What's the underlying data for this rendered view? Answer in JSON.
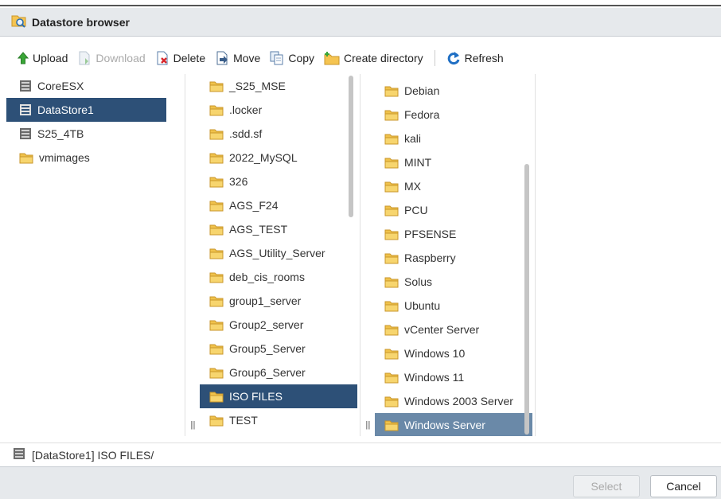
{
  "window": {
    "title": "Datastore browser"
  },
  "toolbar": {
    "upload": "Upload",
    "download": "Download",
    "delete": "Delete",
    "move": "Move",
    "copy": "Copy",
    "create_directory": "Create directory",
    "refresh": "Refresh"
  },
  "columns": {
    "datastores": [
      "CoreESX",
      "DataStore1",
      "S25_4TB",
      "vmimages"
    ],
    "datastore_selected": "DataStore1",
    "folders": [
      "_S25_MSE",
      ".locker",
      ".sdd.sf",
      "2022_MySQL",
      "326",
      "AGS_F24",
      "AGS_TEST",
      "AGS_Utility_Server",
      "deb_cis_rooms",
      "group1_server",
      "Group2_server",
      "Group5_Server",
      "Group6_Server",
      "ISO FILES",
      "TEST"
    ],
    "folder_selected": "ISO FILES",
    "iso_folders": [
      "Debian",
      "Fedora",
      "kali",
      "MINT",
      "MX",
      "PCU",
      "PFSENSE",
      "Raspberry",
      "Solus",
      "Ubuntu",
      "vCenter Server",
      "Windows 10",
      "Windows 11",
      "Windows 2003 Server",
      "Windows Server"
    ],
    "iso_selected": "Windows Server"
  },
  "status": {
    "path": "[DataStore1] ISO FILES/"
  },
  "footer": {
    "select": "Select",
    "cancel": "Cancel"
  },
  "colors": {
    "selected": "#2d5077",
    "selected_light": "#6a89a8",
    "folder": "#f0c24b"
  }
}
